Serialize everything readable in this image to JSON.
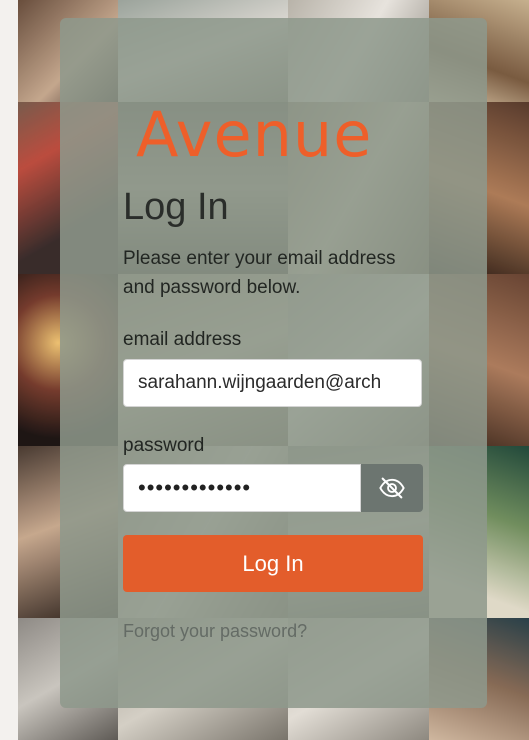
{
  "brand": {
    "logo_text": "Avenue",
    "accent_color": "#ee5f2a"
  },
  "login": {
    "title": "Log In",
    "subtitle": "Please enter your email address and password below.",
    "email_label": "email address",
    "email_value": "sarahann.wijngaarden@arch",
    "password_label": "password",
    "password_value": "•••••••••••••",
    "toggle_visibility_icon": "eye-slash-icon",
    "submit_label": "Log In",
    "forgot_label": "Forgot your password?"
  },
  "colors": {
    "card": "#8e998c",
    "button": "#e35d2b",
    "toggle": "#6c7570"
  }
}
